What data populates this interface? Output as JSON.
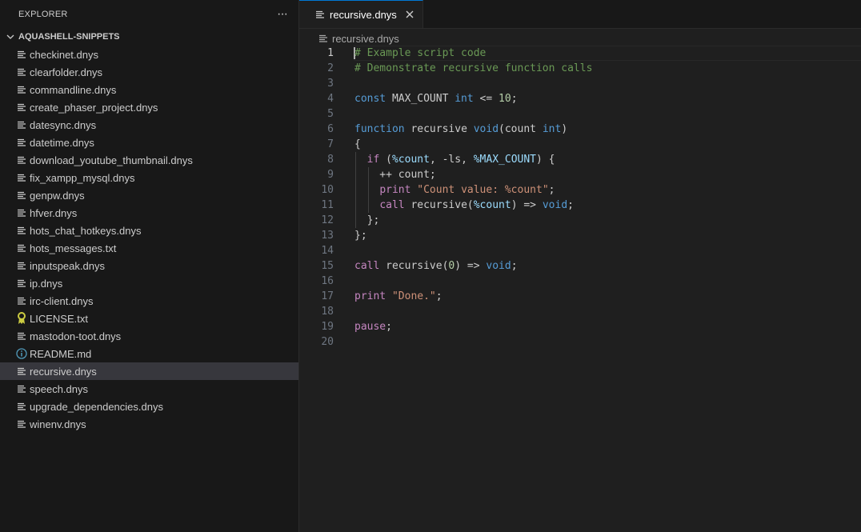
{
  "explorer": {
    "title": "EXPLORER",
    "more_actions": "···",
    "folder": {
      "name": "AQUASHELL-SNIPPETS",
      "files": [
        {
          "name": "checkinet.dnys",
          "icon": "lines-file-icon"
        },
        {
          "name": "clearfolder.dnys",
          "icon": "lines-file-icon"
        },
        {
          "name": "commandline.dnys",
          "icon": "lines-file-icon"
        },
        {
          "name": "create_phaser_project.dnys",
          "icon": "lines-file-icon"
        },
        {
          "name": "datesync.dnys",
          "icon": "lines-file-icon"
        },
        {
          "name": "datetime.dnys",
          "icon": "lines-file-icon"
        },
        {
          "name": "download_youtube_thumbnail.dnys",
          "icon": "lines-file-icon"
        },
        {
          "name": "fix_xampp_mysql.dnys",
          "icon": "lines-file-icon"
        },
        {
          "name": "genpw.dnys",
          "icon": "lines-file-icon"
        },
        {
          "name": "hfver.dnys",
          "icon": "lines-file-icon"
        },
        {
          "name": "hots_chat_hotkeys.dnys",
          "icon": "lines-file-icon"
        },
        {
          "name": "hots_messages.txt",
          "icon": "lines-file-icon"
        },
        {
          "name": "inputspeak.dnys",
          "icon": "lines-file-icon"
        },
        {
          "name": "ip.dnys",
          "icon": "lines-file-icon"
        },
        {
          "name": "irc-client.dnys",
          "icon": "lines-file-icon"
        },
        {
          "name": "LICENSE.txt",
          "icon": "license-icon"
        },
        {
          "name": "mastodon-toot.dnys",
          "icon": "lines-file-icon"
        },
        {
          "name": "README.md",
          "icon": "info-icon"
        },
        {
          "name": "recursive.dnys",
          "icon": "lines-file-icon",
          "active": true
        },
        {
          "name": "speech.dnys",
          "icon": "lines-file-icon"
        },
        {
          "name": "upgrade_dependencies.dnys",
          "icon": "lines-file-icon"
        },
        {
          "name": "winenv.dnys",
          "icon": "lines-file-icon"
        }
      ]
    }
  },
  "editor": {
    "tab": {
      "label": "recursive.dnys"
    },
    "breadcrumb": "recursive.dnys",
    "current_line": 1,
    "lines": [
      [
        [
          "# Example script code",
          "com"
        ]
      ],
      [
        [
          "# Demonstrate recursive function calls",
          "com"
        ]
      ],
      [],
      [
        [
          "const",
          "dec"
        ],
        [
          " MAX_COUNT ",
          "id"
        ],
        [
          "int",
          "type"
        ],
        [
          " <= ",
          "id"
        ],
        [
          "10",
          "num"
        ],
        [
          ";",
          "id"
        ]
      ],
      [],
      [
        [
          "function",
          "dec"
        ],
        [
          " recursive ",
          "id"
        ],
        [
          "void",
          "type"
        ],
        [
          "(",
          "b1"
        ],
        [
          "count ",
          "id"
        ],
        [
          "int",
          "type"
        ],
        [
          ")",
          "b1"
        ]
      ],
      [
        [
          "{",
          "b1"
        ]
      ],
      [
        [
          "  ",
          "id"
        ],
        [
          "if",
          "kw"
        ],
        [
          " ",
          "id"
        ],
        [
          "(",
          "b2"
        ],
        [
          "%count",
          "var"
        ],
        [
          ", -ls, ",
          "id"
        ],
        [
          "%MAX_COUNT",
          "var"
        ],
        [
          ")",
          "b2"
        ],
        [
          " ",
          "id"
        ],
        [
          "{",
          "b2"
        ]
      ],
      [
        [
          "    ++ count;",
          "id"
        ]
      ],
      [
        [
          "    ",
          "id"
        ],
        [
          "print",
          "kw"
        ],
        [
          " ",
          "id"
        ],
        [
          "\"Count value: %count\"",
          "str"
        ],
        [
          ";",
          "id"
        ]
      ],
      [
        [
          "    ",
          "id"
        ],
        [
          "call",
          "kw"
        ],
        [
          " recursive",
          "id"
        ],
        [
          "(",
          "b3"
        ],
        [
          "%count",
          "var"
        ],
        [
          ")",
          "b3"
        ],
        [
          " => ",
          "id"
        ],
        [
          "void",
          "type"
        ],
        [
          ";",
          "id"
        ]
      ],
      [
        [
          "  ",
          "id"
        ],
        [
          "}",
          "b2"
        ],
        [
          ";",
          "id"
        ]
      ],
      [
        [
          "}",
          "b1"
        ],
        [
          ";",
          "id"
        ]
      ],
      [],
      [
        [
          "call",
          "kw"
        ],
        [
          " recursive",
          "id"
        ],
        [
          "(",
          "b1"
        ],
        [
          "0",
          "num"
        ],
        [
          ")",
          "b1"
        ],
        [
          " => ",
          "id"
        ],
        [
          "void",
          "type"
        ],
        [
          ";",
          "id"
        ]
      ],
      [],
      [
        [
          "print",
          "kw"
        ],
        [
          " ",
          "id"
        ],
        [
          "\"Done.\"",
          "str"
        ],
        [
          ";",
          "id"
        ]
      ],
      [],
      [
        [
          "pause",
          "kw"
        ],
        [
          ";",
          "id"
        ]
      ],
      []
    ]
  },
  "colors": {
    "accent": "#0078d4",
    "comment": "#6a9955",
    "keyword": "#c586c0",
    "string": "#ce9178"
  }
}
